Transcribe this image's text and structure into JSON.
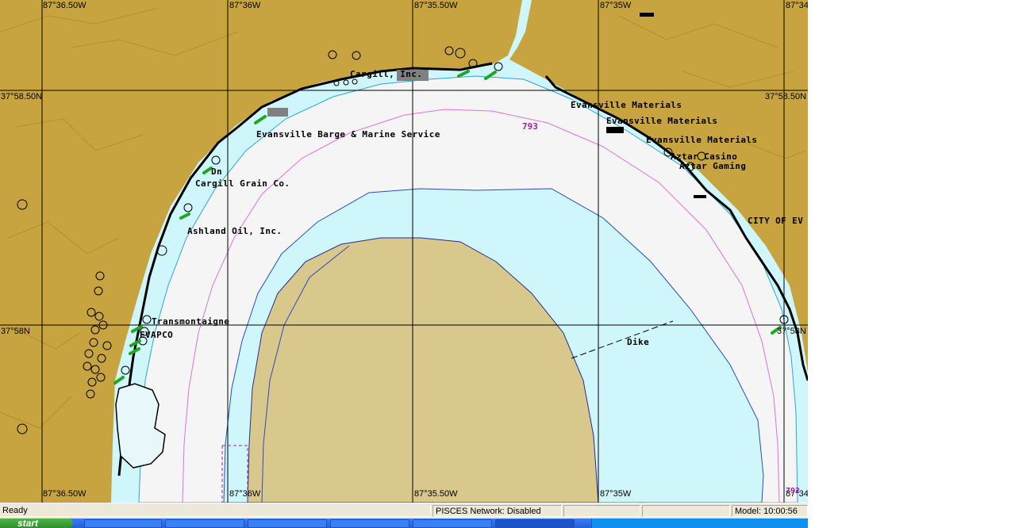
{
  "coordinates": {
    "top": [
      "87°36.50W",
      "87°36W",
      "87°35.50W",
      "87°35W",
      "87°34"
    ],
    "bottom": [
      "87°36.50W",
      "87°36W",
      "87°35.50W",
      "87°35W",
      "87°34"
    ],
    "left": [
      "37°58.50N",
      "37°58N"
    ],
    "right": [
      "37°58.50N",
      "37°58N"
    ]
  },
  "features": {
    "cargill_top": "Cargill, Inc.",
    "barge": "Evansville Barge & Marine Service",
    "dn": "Dn",
    "cargill_grain": "Cargill Grain Co.",
    "ashland": "Ashland Oil, Inc.",
    "transmontaigne": "Transmontaigne",
    "evapco": "EVAPCO",
    "materials_1": "Evansville Materials",
    "materials_2": "Evansville Materials",
    "materials_3": "Evansville Materials",
    "aztar_casino": "Aztar Casino",
    "aztar_gaming": "Aztar Gaming",
    "city": "CITY OF EV",
    "dike": "Dike",
    "mile_marker": "793",
    "corner_marker": "792"
  },
  "status_bar": {
    "ready": "Ready",
    "network": "PISCES Network: Disabled",
    "model": "Model: 10:00:56"
  },
  "taskbar": {
    "start_label": "start"
  },
  "colors": {
    "land": "#c7a43f",
    "shallow": "#cef6fb",
    "channel": "#f5f5f5",
    "bar": "#d8c88b",
    "shoreline": "#000000",
    "sailing_line": "#e070e0"
  }
}
